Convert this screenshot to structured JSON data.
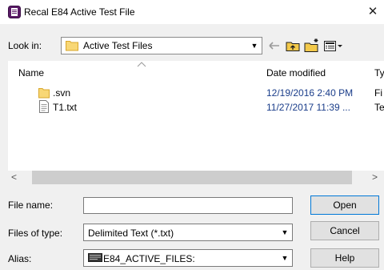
{
  "window": {
    "title": "Recal E84 Active Test File",
    "close_glyph": "✕",
    "app_icon": "app-icon"
  },
  "look_in": {
    "label": "Look in:",
    "value": "Active Test Files",
    "folder_icon": "folder-icon"
  },
  "toolbar": {
    "icons": [
      "back-arrow-icon",
      "up-folder-icon",
      "new-folder-icon",
      "view-menu-icon"
    ]
  },
  "columns": [
    {
      "label": "Name"
    },
    {
      "label": "Date modified"
    },
    {
      "label": "Ty"
    }
  ],
  "files": [
    {
      "name": ".svn",
      "date": "12/19/2016 2:40 PM",
      "type": "Fi",
      "icon": "folder-icon"
    },
    {
      "name": "T1.txt",
      "date": "11/27/2017 11:39 ...",
      "type": "Te",
      "icon": "text-file-icon"
    }
  ],
  "scroll": {
    "left": "<",
    "right": ">"
  },
  "file_name": {
    "label": "File name:",
    "value": ""
  },
  "file_type": {
    "label": "Files of type:",
    "value": "Delimited Text (*.txt)"
  },
  "alias": {
    "label": "Alias:",
    "value": "E84_ACTIVE_FILES:",
    "icon": "drive-icon"
  },
  "buttons": {
    "open": "Open",
    "cancel": "Cancel",
    "help": "Help"
  },
  "colors": {
    "dialog_bg": "#f0f0f0",
    "list_bg": "#ffffff",
    "primary_border": "#0078d7",
    "date_text": "#1a3d8a"
  }
}
